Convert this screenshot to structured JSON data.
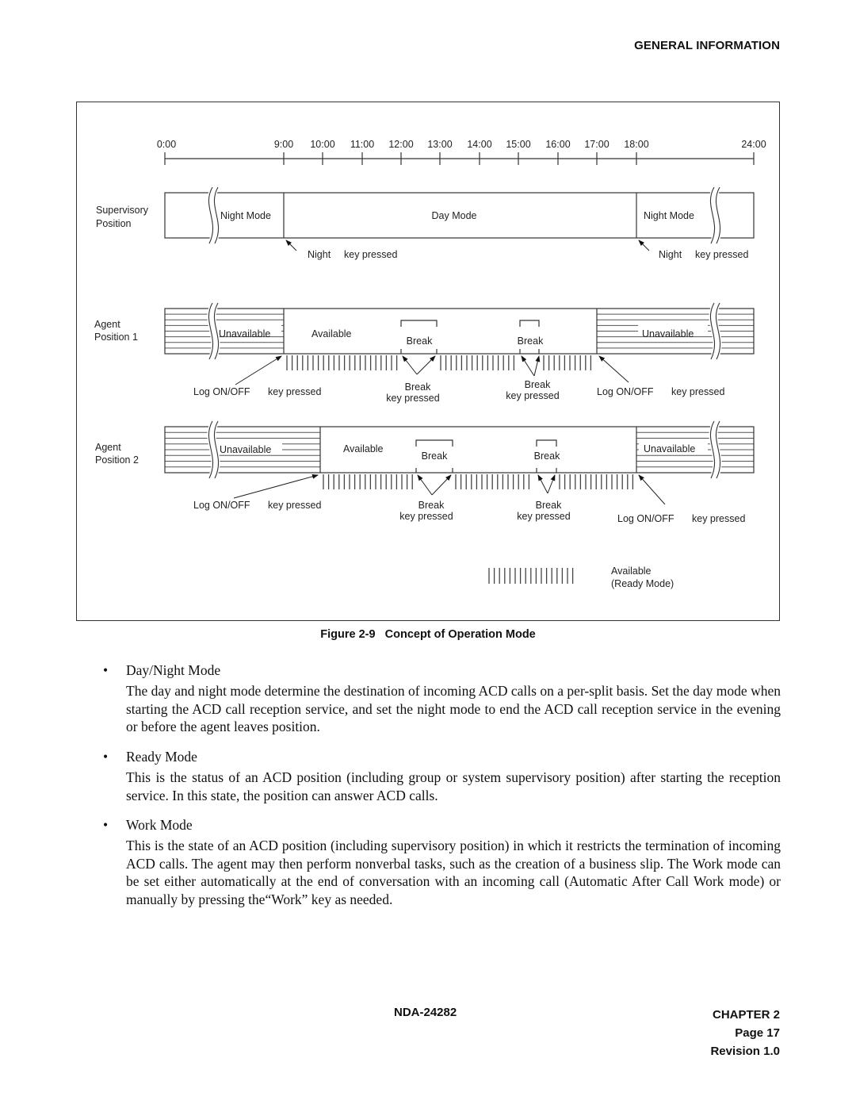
{
  "header": {
    "section_title": "GENERAL INFORMATION"
  },
  "figure": {
    "caption_number": "Figure 2-9",
    "caption_title": "Concept of Operation Mode",
    "timeline": {
      "ticks": [
        "0:00",
        "9:00",
        "10:00",
        "11:00",
        "12:00",
        "13:00",
        "14:00",
        "15:00",
        "16:00",
        "17:00",
        "18:00",
        "24:00"
      ]
    },
    "rows": {
      "supervisory": {
        "label_line1": "Supervisory",
        "label_line2": "Position",
        "segments": {
          "night_start": "Night Mode",
          "day": "Day Mode",
          "night_end": "Night Mode"
        },
        "annotations": {
          "left": {
            "word1": "Night",
            "word2": "key pressed"
          },
          "right": {
            "word1": "Night",
            "word2": "key pressed"
          }
        }
      },
      "agent1": {
        "label_line1": "Agent",
        "label_line2": "Position 1",
        "unavailable_left": "Unavailable",
        "available": "Available",
        "break1": "Break",
        "break2": "Break",
        "unavailable_right": "Unavailable",
        "annotations": {
          "logon_left": {
            "word1": "Log ON/OFF",
            "word2": "key pressed"
          },
          "break1": {
            "line1": "Break",
            "line2": "key  pressed"
          },
          "break2": {
            "line1": "Break",
            "line2": "key  pressed"
          },
          "logon_right": {
            "word1": "Log ON/OFF",
            "word2": "key pressed"
          }
        }
      },
      "agent2": {
        "label_line1": "Agent",
        "label_line2": "Position 2",
        "unavailable_left": "Unavailable",
        "available": "Available",
        "break1": "Break",
        "break2": "Break",
        "unavailable_right": "Unavailable",
        "annotations": {
          "logon_left": {
            "word1": "Log ON/OFF",
            "word2": "key pressed"
          },
          "break1": {
            "line1": "Break",
            "line2": "key  pressed"
          },
          "break2": {
            "line1": "Break",
            "line2": "key  pressed"
          },
          "logon_right": {
            "word1": "Log ON/OFF",
            "word2": "key pressed"
          }
        }
      }
    },
    "legend": {
      "line1": "Available",
      "line2": "(Ready Mode)"
    }
  },
  "sections": [
    {
      "bullet": "•",
      "title": "Day/Night Mode",
      "text": "The day and night mode determine the destination of incoming ACD calls on a per-split basis. Set the day mode when starting the ACD call reception service, and set the night mode to end the ACD call reception service in the evening or before the agent leaves position."
    },
    {
      "bullet": "•",
      "title": "Ready Mode",
      "text": "This is the status of an ACD position (including group or system supervisory position) after starting the reception service. In this state, the position can answer ACD calls."
    },
    {
      "bullet": "•",
      "title": "Work Mode",
      "text": "This is the state of an ACD position (including supervisory position) in which it restricts the termination of incoming ACD calls. The agent may then perform nonverbal tasks, such as the creation of a business slip. The Work mode can be set either automatically at the end of conversation with an incoming call (Automatic After Call Work mode) or manually by pressing the“Work” key as needed."
    }
  ],
  "footer": {
    "doc_number": "NDA-24282",
    "chapter": "CHAPTER 2",
    "page": "Page 17",
    "revision": "Revision 1.0"
  }
}
